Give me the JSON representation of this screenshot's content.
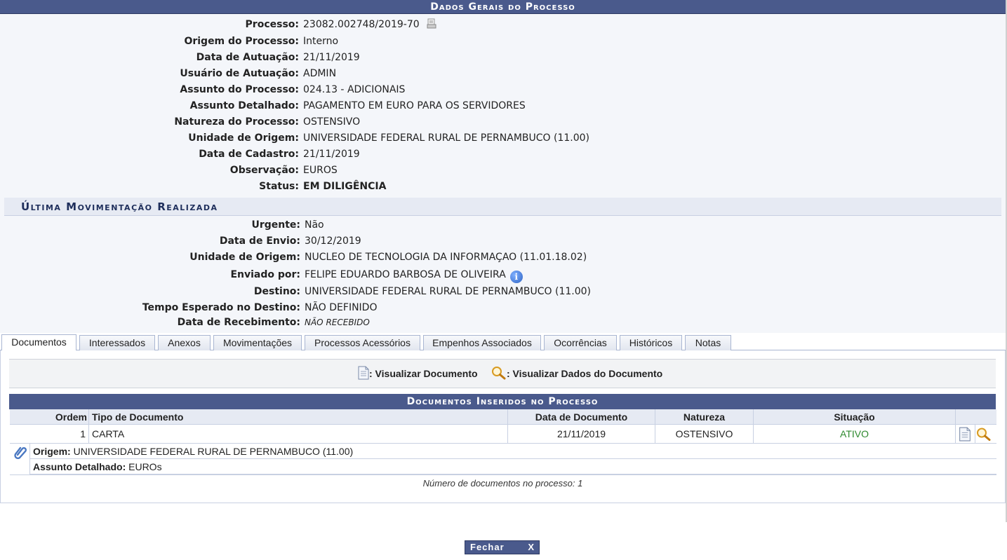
{
  "header": {
    "title": "Dados Gerais do Processo"
  },
  "process": [
    {
      "label": "Processo:",
      "value": "23082.002748/2019-70"
    },
    {
      "label": "Origem do Processo:",
      "value": "Interno"
    },
    {
      "label": "Data de Autuação:",
      "value": "21/11/2019"
    },
    {
      "label": "Usuário de Autuação:",
      "value": "ADMIN"
    },
    {
      "label": "Assunto do Processo:",
      "value": "024.13 - ADICIONAIS"
    },
    {
      "label": "Assunto Detalhado:",
      "value": "PAGAMENTO EM EURO PARA OS SERVIDORES"
    },
    {
      "label": "Natureza do Processo:",
      "value": "OSTENSIVO"
    },
    {
      "label": "Unidade de Origem:",
      "value": "UNIVERSIDADE FEDERAL RURAL DE PERNAMBUCO (11.00)"
    },
    {
      "label": "Data de Cadastro:",
      "value": "21/11/2019"
    },
    {
      "label": "Observação:",
      "value": "EUROS"
    },
    {
      "label": "Status:",
      "value": "EM DILIGÊNCIA"
    }
  ],
  "last_movement": {
    "title": "Última Movimentação Realizada",
    "rows": [
      {
        "label": "Urgente:",
        "value": "Não"
      },
      {
        "label": "Data de Envio:",
        "value": "30/12/2019"
      },
      {
        "label": "Unidade de Origem:",
        "value": "NUCLEO DE TECNOLOGIA DA INFORMAÇAO (11.01.18.02)"
      },
      {
        "label": "Enviado por:",
        "value": "FELIPE EDUARDO BARBOSA DE OLIVEIRA"
      },
      {
        "label": "Destino:",
        "value": "UNIVERSIDADE FEDERAL RURAL DE PERNAMBUCO (11.00)"
      },
      {
        "label": "Tempo Esperado no Destino:",
        "value": "NÃO DEFINIDO"
      },
      {
        "label": "Data de Recebimento:",
        "value": "NÃO RECEBIDO"
      }
    ]
  },
  "tabs": [
    {
      "label": "Documentos"
    },
    {
      "label": "Interessados"
    },
    {
      "label": "Anexos"
    },
    {
      "label": "Movimentações"
    },
    {
      "label": "Processos Acessórios"
    },
    {
      "label": "Empenhos Associados"
    },
    {
      "label": "Ocorrências"
    },
    {
      "label": "Históricos"
    },
    {
      "label": "Notas"
    }
  ],
  "legend": {
    "view_document": ": Visualizar Documento",
    "view_document_data": ": Visualizar Dados do Documento"
  },
  "documents": {
    "caption": "Documentos Inseridos no Processo",
    "headers": {
      "ordem": "Ordem",
      "tipo": "Tipo de Documento",
      "data": "Data de Documento",
      "natureza": "Natureza",
      "situacao": "Situação"
    },
    "rows": [
      {
        "ordem": "1",
        "tipo": "CARTA",
        "data": "21/11/2019",
        "natureza": "OSTENSIVO",
        "situacao": "ATIVO",
        "origem_label": "Origem:",
        "origem": "UNIVERSIDADE FEDERAL RURAL DE PERNAMBUCO (11.00)",
        "assunto_label": "Assunto Detalhado:",
        "assunto": "EUROs"
      }
    ],
    "count_text": "Número de documentos no processo: 1"
  },
  "footer": {
    "close_label": "Fechar",
    "close_x": "X"
  },
  "colors": {
    "header_bg": "#4a5a8c",
    "panel_bg": "#f4f6fa",
    "status": "#f09c1a",
    "not_received": "#dd1111",
    "active": "#2f8a2f"
  }
}
